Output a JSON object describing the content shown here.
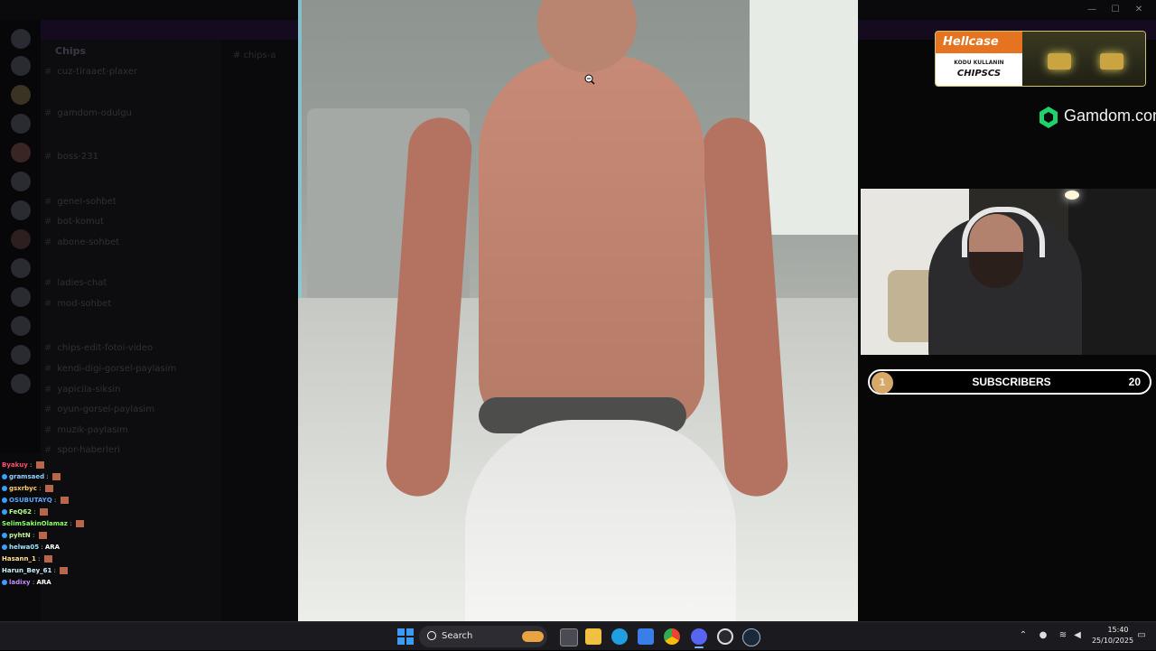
{
  "discord": {
    "server_name": "Chips",
    "channel_header": "chips-a",
    "channels": [
      {
        "label": "cuz-tiraaet-plaxer"
      },
      {
        "label": "gamdom-odulgu"
      },
      {
        "label": "boss-231"
      },
      {
        "label": "genel-sohbet"
      },
      {
        "label": "bot-komut"
      },
      {
        "label": "abone-sohbet"
      },
      {
        "label": "ladies-chat"
      },
      {
        "label": "mod-sohbet"
      },
      {
        "label": "chips-edit-fotoi-video"
      },
      {
        "label": "kendi-digi-gorsel-paylasim"
      },
      {
        "label": "yapicila-siksin"
      },
      {
        "label": "oyun-gorsel-paylasim"
      },
      {
        "label": "muzik-paylasim"
      },
      {
        "label": "spor-haberleri"
      }
    ]
  },
  "sponsors": {
    "hellcase": {
      "brand": "Hellcase",
      "promo_line1": "KODU KULLANIN",
      "promo_line2": "CHIPSCS"
    },
    "gamdom": {
      "label": "Gamdom.com",
      "icon": "gamdom-logo-icon"
    }
  },
  "subscriber_goal": {
    "current": "1",
    "label": "SUBSCRIBERS",
    "target": "20",
    "progress_fraction": 0.05
  },
  "chat": [
    {
      "user": "Byakuy",
      "color": "#ff4d6d",
      "text": "",
      "emote": true
    },
    {
      "user": "gramsaed",
      "color": "#8fd3ff",
      "text": "",
      "emote": true,
      "badge": true
    },
    {
      "user": "gsxrbyc",
      "color": "#ffd166",
      "text": "",
      "emote": true,
      "badge": true
    },
    {
      "user": "OSUBUTAYQ",
      "color": "#5aa9ff",
      "text": "",
      "emote": true,
      "badge": true
    },
    {
      "user": "FeQ62",
      "color": "#b6ff8a",
      "text": "",
      "emote": true,
      "badge": true
    },
    {
      "user": "SelimSakinOlamaz",
      "color": "#8cff6b",
      "text": "",
      "emote": true
    },
    {
      "user": "pyhtN",
      "color": "#c7f59b",
      "text": "",
      "emote": true,
      "badge": true
    },
    {
      "user": "helwa05",
      "color": "#9fe6ff",
      "text": "ARA",
      "emote": false,
      "badge": true
    },
    {
      "user": "Hasann_1",
      "color": "#ffe08a",
      "text": "",
      "emote": true
    },
    {
      "user": "Harun_Bey_61",
      "color": "#c9f2ff",
      "text": "",
      "emote": true
    },
    {
      "user": "ladixy",
      "color": "#c78bff",
      "text": "ARA",
      "emote": false,
      "badge": true
    }
  ],
  "taskbar": {
    "search_label": "Search",
    "time": "15:40",
    "date": "25/10/2025",
    "apps": [
      {
        "name": "start-icon"
      },
      {
        "name": "task-view-icon"
      },
      {
        "name": "file-explorer-icon"
      },
      {
        "name": "edge-icon"
      },
      {
        "name": "store-icon"
      },
      {
        "name": "chrome-icon"
      },
      {
        "name": "discord-icon"
      },
      {
        "name": "obs-icon"
      },
      {
        "name": "steam-icon"
      }
    ]
  },
  "colors": {
    "accent": "#3b9cf5",
    "hellcase_orange": "#e6731f",
    "gamdom_green": "#1fd36a",
    "subscriber_gold": "#d6a86a"
  }
}
